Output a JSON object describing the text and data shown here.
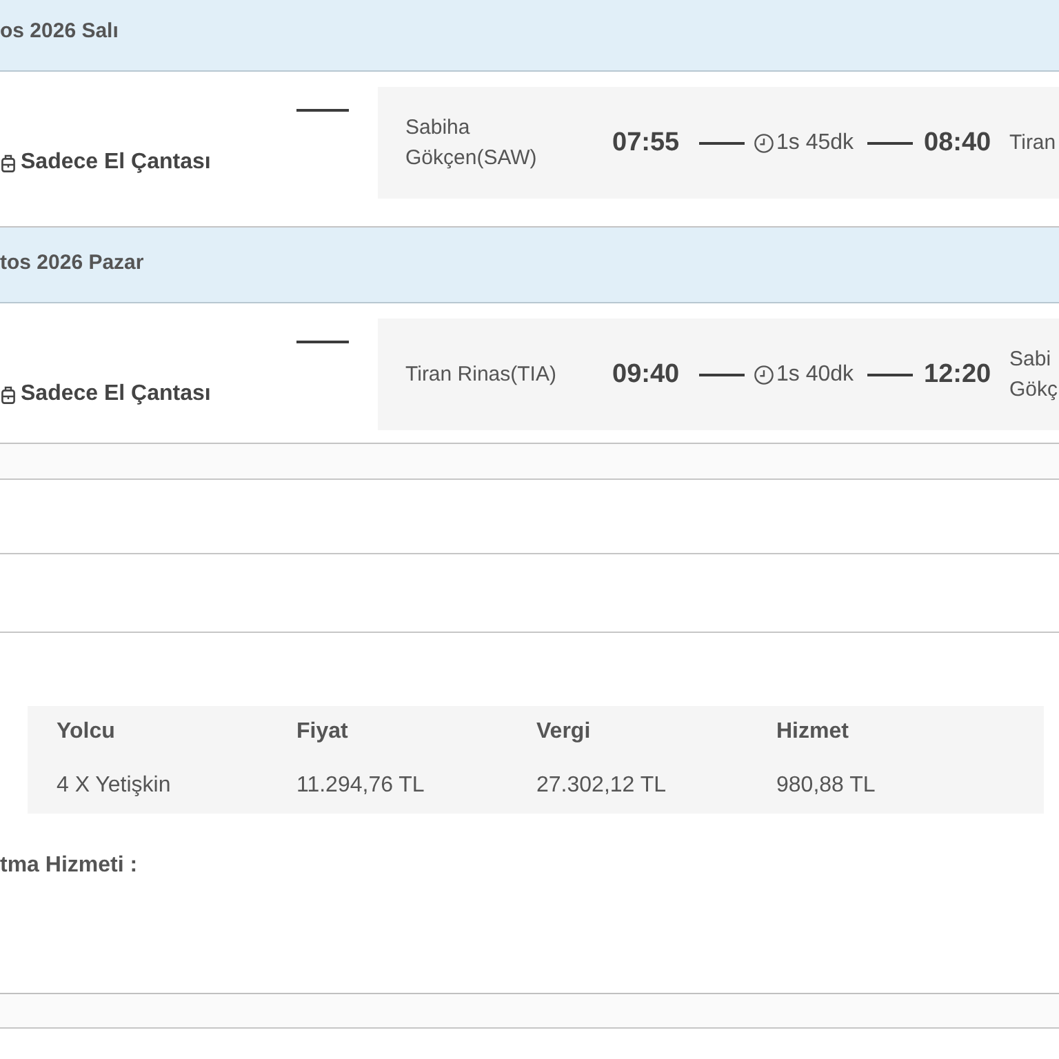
{
  "flights": [
    {
      "date": "os 2026 Salı",
      "baggage": "Sadece El Çantası",
      "origin": "Sabiha Gökçen(SAW)",
      "departure": "07:55",
      "duration": "1s 45dk",
      "arrival": "08:40",
      "destination": "Tiran"
    },
    {
      "date": "tos 2026 Pazar",
      "baggage": "Sadece El Çantası",
      "origin": "Tiran Rinas(TIA)",
      "departure": "09:40",
      "duration": "1s 40dk",
      "arrival": "12:20",
      "destination": "Sabi Gökç"
    }
  ],
  "fare_table": {
    "columns": [
      "Yolcu",
      "Fiyat",
      "Vergi",
      "Hizmet"
    ],
    "rows": [
      [
        "4 X Yetişkin",
        "11.294,76 TL",
        "27.302,12 TL",
        "980,88 TL"
      ]
    ]
  },
  "service_label": "tma Hizmeti :"
}
